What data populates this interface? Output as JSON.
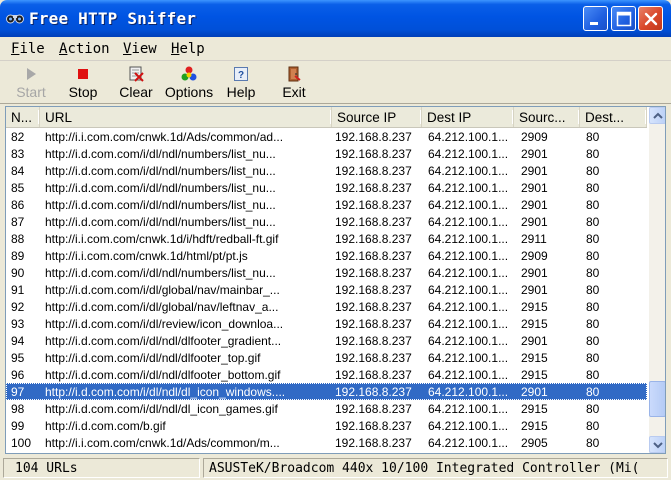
{
  "window": {
    "title": "Free HTTP Sniffer",
    "title_bar_color": "#0054e3",
    "controls": [
      "minimize-icon",
      "maximize-icon",
      "close-icon"
    ]
  },
  "menu": {
    "items": [
      {
        "hotkey": "F",
        "rest": "ile"
      },
      {
        "hotkey": "A",
        "rest": "ction"
      },
      {
        "hotkey": "V",
        "rest": "iew"
      },
      {
        "hotkey": "H",
        "rest": "elp"
      }
    ]
  },
  "toolbar": {
    "buttons": [
      {
        "label": "Start",
        "icon": "play-icon",
        "enabled": false
      },
      {
        "label": "Stop",
        "icon": "stop-icon",
        "enabled": true
      },
      {
        "label": "Clear",
        "icon": "clear-icon",
        "enabled": true
      },
      {
        "label": "Options",
        "icon": "options-icon",
        "enabled": true
      },
      {
        "label": "Help",
        "icon": "help-icon",
        "enabled": true
      },
      {
        "label": "Exit",
        "icon": "exit-icon",
        "enabled": true
      }
    ]
  },
  "table": {
    "columns": [
      "N...",
      "URL",
      "Source IP",
      "Dest IP",
      "Sourc...",
      "Dest..."
    ],
    "selected_row": 97,
    "selection_color": "#316ac5",
    "rows": [
      [
        "82",
        "http://i.i.com.com/cnwk.1d/Ads/common/ad...",
        "192.168.8.237",
        "64.212.100.1...",
        "2909",
        "80"
      ],
      [
        "83",
        "http://i.d.com.com/i/dl/ndl/numbers/list_nu...",
        "192.168.8.237",
        "64.212.100.1...",
        "2901",
        "80"
      ],
      [
        "84",
        "http://i.d.com.com/i/dl/ndl/numbers/list_nu...",
        "192.168.8.237",
        "64.212.100.1...",
        "2901",
        "80"
      ],
      [
        "85",
        "http://i.d.com.com/i/dl/ndl/numbers/list_nu...",
        "192.168.8.237",
        "64.212.100.1...",
        "2901",
        "80"
      ],
      [
        "86",
        "http://i.d.com.com/i/dl/ndl/numbers/list_nu...",
        "192.168.8.237",
        "64.212.100.1...",
        "2901",
        "80"
      ],
      [
        "87",
        "http://i.d.com.com/i/dl/ndl/numbers/list_nu...",
        "192.168.8.237",
        "64.212.100.1...",
        "2901",
        "80"
      ],
      [
        "88",
        "http://i.i.com.com/cnwk.1d/i/hdft/redball-ft.gif",
        "192.168.8.237",
        "64.212.100.1...",
        "2911",
        "80"
      ],
      [
        "89",
        "http://i.i.com.com/cnwk.1d/html/pt/pt.js",
        "192.168.8.237",
        "64.212.100.1...",
        "2909",
        "80"
      ],
      [
        "90",
        "http://i.d.com.com/i/dl/ndl/numbers/list_nu...",
        "192.168.8.237",
        "64.212.100.1...",
        "2901",
        "80"
      ],
      [
        "91",
        "http://i.d.com.com/i/dl/global/nav/mainbar_...",
        "192.168.8.237",
        "64.212.100.1...",
        "2901",
        "80"
      ],
      [
        "92",
        "http://i.d.com.com/i/dl/global/nav/leftnav_a...",
        "192.168.8.237",
        "64.212.100.1...",
        "2915",
        "80"
      ],
      [
        "93",
        "http://i.d.com.com/i/dl/review/icon_downloa...",
        "192.168.8.237",
        "64.212.100.1...",
        "2915",
        "80"
      ],
      [
        "94",
        "http://i.d.com.com/i/dl/ndl/dlfooter_gradient...",
        "192.168.8.237",
        "64.212.100.1...",
        "2901",
        "80"
      ],
      [
        "95",
        "http://i.d.com.com/i/dl/ndl/dlfooter_top.gif",
        "192.168.8.237",
        "64.212.100.1...",
        "2915",
        "80"
      ],
      [
        "96",
        "http://i.d.com.com/i/dl/ndl/dlfooter_bottom.gif",
        "192.168.8.237",
        "64.212.100.1...",
        "2915",
        "80"
      ],
      [
        "97",
        "http://i.d.com.com/i/dl/ndl/dl_icon_windows....",
        "192.168.8.237",
        "64.212.100.1...",
        "2901",
        "80"
      ],
      [
        "98",
        "http://i.d.com.com/i/dl/ndl/dl_icon_games.gif",
        "192.168.8.237",
        "64.212.100.1...",
        "2915",
        "80"
      ],
      [
        "99",
        "http://i.d.com.com/b.gif",
        "192.168.8.237",
        "64.212.100.1...",
        "2915",
        "80"
      ],
      [
        "100",
        "http://i.i.com.com/cnwk.1d/Ads/common/m...",
        "192.168.8.237",
        "64.212.100.1...",
        "2905",
        "80"
      ]
    ]
  },
  "scrollbar": {
    "position_fraction": 0.93
  },
  "status": {
    "left": "104 URLs",
    "right": "ASUSTeK/Broadcom 440x 10/100 Integrated Controller (Mi("
  }
}
